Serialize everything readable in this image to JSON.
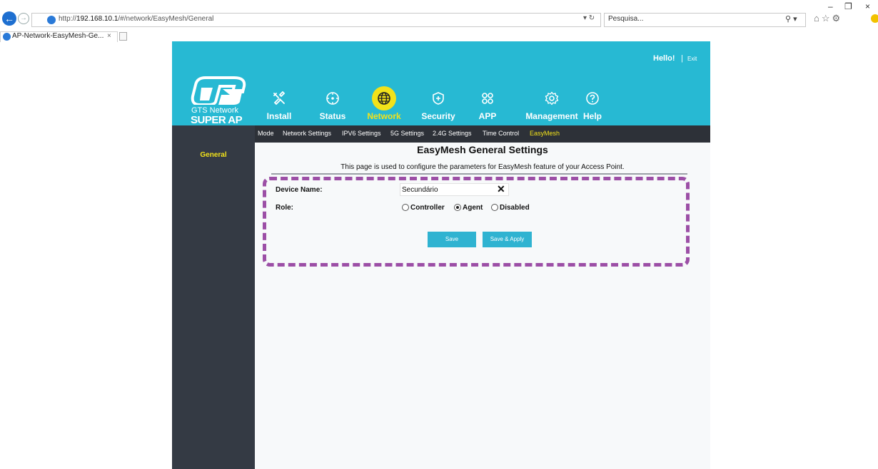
{
  "browser": {
    "url_prefix": "http://",
    "url_host": "192.168.10.1",
    "url_path": "/#/network/EasyMesh/General",
    "search_placeholder": "Pesquisa...",
    "tab_title": "AP-Network-EasyMesh-Ge...",
    "tab_close": "×",
    "minimize": "–",
    "restore": "❐",
    "close": "×"
  },
  "header": {
    "greeting": "Hello!",
    "separator": "|",
    "exit": "Exit",
    "logo_line1": "GTS Network",
    "logo_line2": "SUPER AP"
  },
  "menu": [
    {
      "label": "Install",
      "icon": "tools-icon"
    },
    {
      "label": "Status",
      "icon": "status-icon"
    },
    {
      "label": "Network",
      "icon": "globe-icon",
      "active": true
    },
    {
      "label": "Security",
      "icon": "shield-icon"
    },
    {
      "label": "APP",
      "icon": "app-icon"
    },
    {
      "label": "Management",
      "icon": "gear-icon"
    },
    {
      "label": "Help",
      "icon": "help-icon"
    }
  ],
  "subnav": [
    "Mode",
    "Network Settings",
    "IPV6 Settings",
    "5G Settings",
    "2.4G Settings",
    "Time Control",
    "EasyMesh"
  ],
  "sidebar": {
    "items": [
      "General"
    ]
  },
  "page": {
    "title": "EasyMesh General Settings",
    "description": "This page is used to configure the parameters for EasyMesh feature of your Access Point."
  },
  "form": {
    "device_name_label": "Device Name:",
    "device_name_value": "Secundário",
    "clear_symbol": "✕",
    "role_label": "Role:",
    "role_options": [
      "Controller",
      "Agent",
      "Disabled"
    ],
    "role_selected": "Agent",
    "save_label": "Save",
    "save_apply_label": "Save & Apply"
  },
  "colors": {
    "header": "#27b9d3",
    "accent": "#f2e21a",
    "sidebar": "#343a44",
    "button": "#2fb3d1",
    "highlight_box": "#9c4fa6"
  }
}
